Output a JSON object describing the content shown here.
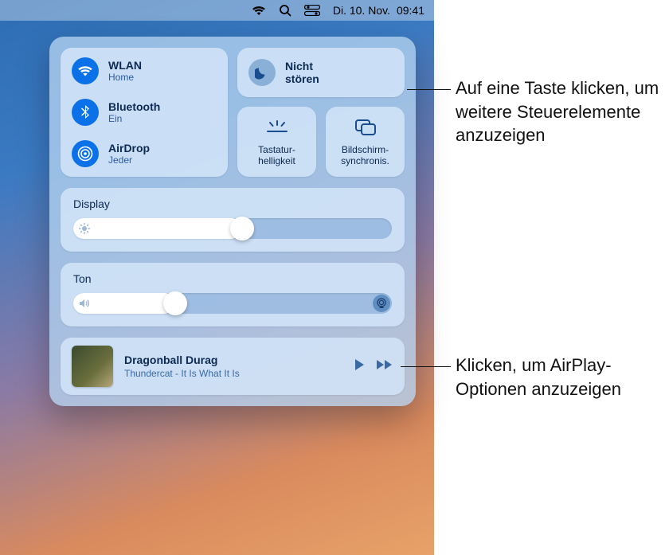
{
  "menubar": {
    "date": "Di. 10. Nov.",
    "time": "09:41"
  },
  "controlCenter": {
    "connectivity": {
      "wlan": {
        "title": "WLAN",
        "sub": "Home"
      },
      "bluetooth": {
        "title": "Bluetooth",
        "sub": "Ein"
      },
      "airdrop": {
        "title": "AirDrop",
        "sub": "Jeder"
      }
    },
    "dnd": {
      "label": "Nicht\nstören"
    },
    "keyboardBrightness": {
      "label": "Tastatur-\nhelligkeit"
    },
    "screenMirroring": {
      "label": "Bildschirm-\nsynchronis."
    },
    "display": {
      "label": "Display",
      "value": 0.53
    },
    "sound": {
      "label": "Ton",
      "value": 0.32
    },
    "nowPlaying": {
      "title": "Dragonball Durag",
      "sub": "Thundercat - It Is What It Is"
    }
  },
  "annotations": {
    "a1": "Auf eine Taste klicken, um weitere Steuerelemente anzuzeigen",
    "a2": "Klicken, um AirPlay-Optionen anzuzeigen"
  }
}
